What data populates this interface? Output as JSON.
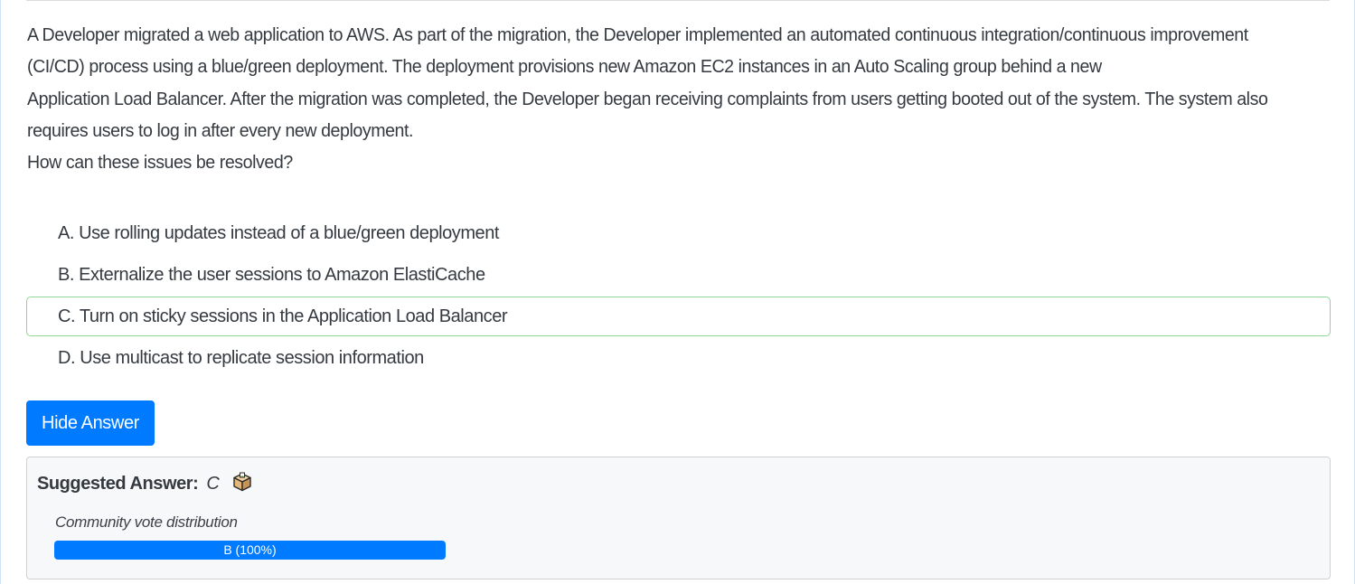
{
  "question": {
    "paragraph_1": "A Developer migrated a web application to AWS. As part of the migration, the Developer implemented an automated continuous integration/continuous improvement (CI/CD) process using a blue/green deployment. The deployment provisions new Amazon EC2 instances in an Auto Scaling group behind a new",
    "paragraph_2": "Application Load Balancer. After the migration was completed, the Developer began receiving complaints from users getting booted out of the system. The system also requires users to log in after every new deployment.",
    "paragraph_3": "How can these issues be resolved?"
  },
  "choices": [
    {
      "text": "A. Use rolling updates instead of a blue/green deployment",
      "correct": false
    },
    {
      "text": "B. Externalize the user sessions to Amazon ElastiCache",
      "correct": false
    },
    {
      "text": "C. Turn on sticky sessions in the Application Load Balancer",
      "correct": true
    },
    {
      "text": "D. Use multicast to replicate session information",
      "correct": false
    }
  ],
  "hide_answer_label": "Hide Answer",
  "answer": {
    "suggested_label": "Suggested Answer:",
    "suggested_value": "C",
    "vote_icon": "ballot-box-icon",
    "community_label": "Community vote distribution",
    "votes": [
      {
        "label": "B (100%)",
        "percent": 100
      }
    ]
  },
  "colors": {
    "primary": "#007bff",
    "correct_border": "#8fd69a",
    "answer_box_bg": "#f7f8f9"
  }
}
